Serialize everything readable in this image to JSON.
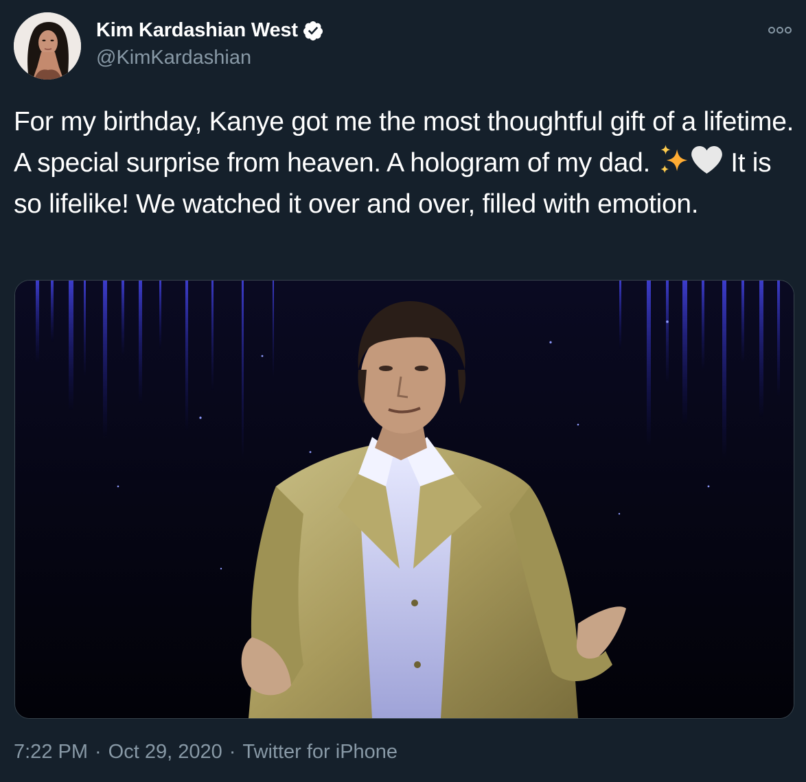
{
  "author": {
    "display_name": "Kim Kardashian West",
    "handle": "@KimKardashian",
    "verified": true
  },
  "tweet": {
    "text_part1": "For my birthday, Kanye got me the most thoughtful gift of a lifetime. A special surprise from heaven. A hologram of my dad.",
    "emojis": [
      "sparkles-emoji",
      "white-heart-emoji"
    ],
    "text_part2": "It is so lifelike! We watched it over and over, filled with emotion."
  },
  "meta": {
    "time": "7:22 PM",
    "date": "Oct 29, 2020",
    "source": "Twitter for iPhone",
    "separator": "·"
  },
  "icons": {
    "more": "more-options-icon",
    "verified": "verified-badge-icon"
  },
  "colors": {
    "background": "#15202b",
    "secondary_text": "#8899a6",
    "verified_badge": "#ffffff",
    "border": "#38444d"
  }
}
